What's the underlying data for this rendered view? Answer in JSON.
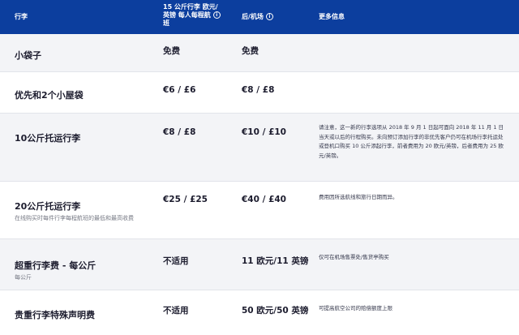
{
  "header": {
    "col_item": "行李",
    "col_online_line1": "15 公斤行李 欧元/",
    "col_online_line2": "英镑 每人每程航",
    "col_online_line3": "班",
    "col_airport": "后/机场",
    "col_info": "更多信息",
    "info_glyph": "i"
  },
  "rows": [
    {
      "name": "小袋子",
      "sub": "",
      "online": "免费",
      "airport": "免费",
      "info": ""
    },
    {
      "name": "优先和2个小屋袋",
      "sub": "",
      "online": "€6 / £6",
      "airport": "€8 / £8",
      "info": ""
    },
    {
      "name": "10公斤托运行李",
      "sub": "",
      "online": "€8 / £8",
      "airport": "€10 / £10",
      "info": "请注意，这一新的行李选项从 2018 年 9 月 1 日起可面向 2018 年 11 月 1 日当天或以后的行程购买。未向预订添加行李的非优先客户仍可在机场行李托运处或登机口购买 10 公斤添起行李，前者费用为 20 欧元/英镑，后者费用为 25 欧元/英镑。"
    },
    {
      "name": "20公斤托运行李",
      "sub": "在线购买时每件行李每程航班的最低和最高收费",
      "online": "€25 / £25",
      "airport": "€40 / £40",
      "info": "费用因所选航线和旅行日期而异。"
    },
    {
      "name": "超重行李费 - 每公斤",
      "sub": "每公斤",
      "online": "不适用",
      "airport": "11 欧元/11 英镑",
      "info": "仅可在机场售票处/售货亭购买"
    },
    {
      "name": "贵重行李特殊声明费",
      "sub": "",
      "online": "不适用",
      "airport": "50 欧元/50 英镑",
      "info": "可提高航空公司的赔偿额度上限"
    }
  ]
}
